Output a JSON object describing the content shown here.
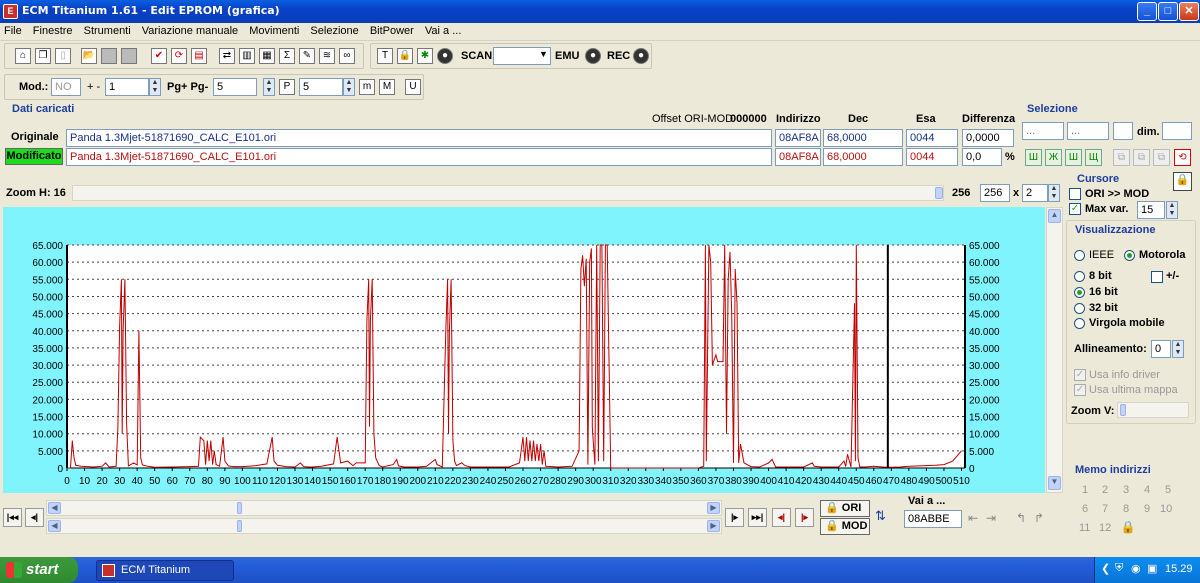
{
  "window": {
    "title": "ECM Titanium 1.61 - Edit EPROM (grafica)",
    "icon": "app-icon"
  },
  "menu": [
    "File",
    "Finestre",
    "Strumenti",
    "Variazione manuale",
    "Movimenti",
    "Selezione",
    "BitPower",
    "Vai a ..."
  ],
  "toolbar1": {
    "scan_label": "SCAN",
    "scan_value": "",
    "emu_label": "EMU",
    "rec_label": "REC"
  },
  "toolbar2": {
    "mod_label": "Mod.:",
    "mod_value": "NO",
    "step_label": "+ -",
    "step_value": "1",
    "pg_label": "Pg+ Pg-",
    "pg_value": "5",
    "p_value": "5"
  },
  "data_panel": {
    "title": "Dati caricati",
    "offset_label": "Offset ORI-MOD",
    "offset_value": "000000",
    "col_indirizzo": "Indirizzo",
    "col_dec": "Dec",
    "col_esa": "Esa",
    "col_diff": "Differenza",
    "orig_label": "Originale",
    "orig_file": "Panda 1.3Mjet-51871690_CALC_E101.ori",
    "orig_addr": "08AF8A",
    "orig_dec": "68,0000",
    "orig_esa": "0044",
    "orig_diff": "0,0000",
    "mod_label": "Modificato",
    "mod_file": "Panda 1.3Mjet-51871690_CALC_E101.ori",
    "mod_addr": "08AF8A",
    "mod_dec": "68,0000",
    "mod_esa": "0044",
    "mod_diff": "0,0",
    "pct": "%"
  },
  "selezione": {
    "title": "Selezione",
    "f1": "...",
    "f2": "...",
    "dim_label": "dim."
  },
  "zoom": {
    "label": "Zoom H: 16",
    "value_text": "256",
    "field": "256",
    "x": "x",
    "mult": "2"
  },
  "cursore": {
    "title": "Cursore",
    "ori_mod": "ORI >> MOD",
    "maxvar_label": "Max var.",
    "maxvar_value": "15"
  },
  "visualizzazione": {
    "title": "Visualizzazione",
    "ieee": "IEEE",
    "motorola": "Motorola",
    "b8": "8 bit",
    "pm": "+/-",
    "b16": "16 bit",
    "b32": "32 bit",
    "virgola": "Virgola mobile",
    "allineamento_label": "Allineamento:",
    "allineamento_value": "0",
    "usa_info": "Usa info driver",
    "usa_ultima": "Usa ultima mappa",
    "zoomv": "Zoom V:"
  },
  "memo": {
    "title": "Memo indirizzi",
    "nums": [
      "1",
      "2",
      "3",
      "4",
      "5",
      "6",
      "7",
      "8",
      "9",
      "10",
      "11",
      "12"
    ]
  },
  "nav": {
    "ori": "ORI",
    "mod": "MOD",
    "vai_label": "Vai a ...",
    "vai_value": "08ABBE"
  },
  "taskbar": {
    "start": "start",
    "item": "ECM Titanium",
    "clock": "15.29"
  },
  "chart_data": {
    "type": "line",
    "title": "",
    "xlabel": "",
    "ylabel": "",
    "xlim": [
      0,
      512
    ],
    "ylim": [
      0,
      65000
    ],
    "x_ticks": [
      0,
      10,
      20,
      30,
      40,
      50,
      60,
      70,
      80,
      90,
      100,
      110,
      120,
      130,
      140,
      150,
      160,
      170,
      180,
      190,
      200,
      210,
      220,
      230,
      240,
      250,
      260,
      270,
      280,
      290,
      300,
      310,
      320,
      330,
      340,
      350,
      360,
      370,
      380,
      390,
      400,
      410,
      420,
      430,
      440,
      450,
      460,
      470,
      480,
      490,
      500,
      510
    ],
    "y_ticks": [
      "0",
      "5.000",
      "10.000",
      "15.000",
      "20.000",
      "25.000",
      "30.000",
      "35.000",
      "40.000",
      "45.000",
      "50.000",
      "55.000",
      "60.000",
      "65.000"
    ],
    "grid": "horizontal dashed",
    "series": [
      {
        "color": "#c00000",
        "points": [
          [
            0,
            0
          ],
          [
            2,
            0
          ],
          [
            3,
            8000
          ],
          [
            4,
            3000
          ],
          [
            5,
            800
          ],
          [
            8,
            500
          ],
          [
            15,
            300
          ],
          [
            20,
            500
          ],
          [
            22,
            1500
          ],
          [
            24,
            300
          ],
          [
            28,
            500
          ],
          [
            29,
            12000
          ],
          [
            30,
            41000
          ],
          [
            31,
            55000
          ],
          [
            31.5,
            10000
          ],
          [
            32,
            40000
          ],
          [
            33,
            55000
          ],
          [
            34,
            13000
          ],
          [
            35,
            600
          ],
          [
            38,
            1500
          ],
          [
            40,
            900
          ],
          [
            41,
            40000
          ],
          [
            42,
            3000
          ],
          [
            43,
            900
          ],
          [
            46,
            500
          ],
          [
            50,
            200
          ],
          [
            60,
            300
          ],
          [
            70,
            400
          ],
          [
            75,
            500
          ],
          [
            76,
            9000
          ],
          [
            78,
            8000
          ],
          [
            79,
            1000
          ],
          [
            80,
            8000
          ],
          [
            81,
            2000
          ],
          [
            82,
            8000
          ],
          [
            83,
            1000
          ],
          [
            84,
            5000
          ],
          [
            85,
            1000
          ],
          [
            87,
            500
          ],
          [
            89,
            9000
          ],
          [
            90,
            2000
          ],
          [
            92,
            600
          ],
          [
            95,
            400
          ],
          [
            100,
            400
          ],
          [
            108,
            700
          ],
          [
            111,
            1000
          ],
          [
            114,
            1200
          ],
          [
            117,
            9000
          ],
          [
            118,
            2000
          ],
          [
            120,
            800
          ],
          [
            125,
            400
          ],
          [
            130,
            300
          ],
          [
            133,
            1500
          ],
          [
            135,
            400
          ],
          [
            138,
            300
          ],
          [
            140,
            300
          ],
          [
            145,
            500
          ],
          [
            152,
            1200
          ],
          [
            154,
            9000
          ],
          [
            156,
            1500
          ],
          [
            160,
            2000
          ],
          [
            163,
            700
          ],
          [
            165,
            1500
          ],
          [
            170,
            1500
          ],
          [
            171,
            43000
          ],
          [
            172,
            55000
          ],
          [
            172.5,
            12000
          ],
          [
            173,
            43000
          ],
          [
            174,
            55000
          ],
          [
            175,
            10000
          ],
          [
            176,
            3000
          ],
          [
            178,
            700
          ],
          [
            180,
            300
          ],
          [
            186,
            1000
          ],
          [
            188,
            2500
          ],
          [
            189,
            600
          ],
          [
            192,
            300
          ],
          [
            200,
            300
          ],
          [
            205,
            500
          ],
          [
            210,
            2500
          ],
          [
            211,
            1000
          ],
          [
            214,
            300
          ],
          [
            216,
            40000
          ],
          [
            217,
            55000
          ],
          [
            217.5,
            10000
          ],
          [
            218,
            40000
          ],
          [
            219,
            55000
          ],
          [
            220,
            8000
          ],
          [
            221,
            2000
          ],
          [
            222,
            700
          ],
          [
            225,
            1500
          ],
          [
            227,
            700
          ],
          [
            230,
            300
          ],
          [
            240,
            300
          ],
          [
            248,
            300
          ],
          [
            252,
            300
          ],
          [
            258,
            1500
          ],
          [
            260,
            9000
          ],
          [
            261,
            2000
          ],
          [
            262,
            9000
          ],
          [
            263,
            2000
          ],
          [
            264,
            8000
          ],
          [
            265,
            2000
          ],
          [
            266,
            8000
          ],
          [
            267,
            2000
          ],
          [
            268,
            7000
          ],
          [
            269,
            2000
          ],
          [
            270,
            7000
          ],
          [
            271,
            1000
          ],
          [
            272,
            5000
          ],
          [
            273,
            500
          ],
          [
            280,
            300
          ],
          [
            288,
            500
          ],
          [
            292,
            5000
          ],
          [
            293,
            58000
          ],
          [
            294,
            62000
          ],
          [
            295,
            53000
          ],
          [
            296,
            61000
          ],
          [
            297,
            1000
          ],
          [
            298,
            60000
          ],
          [
            299,
            64000
          ],
          [
            299.5,
            12000
          ],
          [
            300,
            8000
          ],
          [
            301,
            1000
          ],
          [
            302,
            65000
          ],
          [
            303,
            2000
          ],
          [
            304,
            65000
          ],
          [
            305,
            65000
          ],
          [
            306,
            2000
          ],
          [
            307,
            65000
          ],
          [
            308,
            65000
          ],
          [
            310,
            0
          ],
          [
            312,
            0
          ],
          [
            320,
            0
          ],
          [
            330,
            0
          ],
          [
            340,
            0
          ],
          [
            350,
            0
          ],
          [
            360,
            0
          ],
          [
            363,
            500
          ],
          [
            364,
            65000
          ],
          [
            364.5,
            2000
          ],
          [
            366,
            65000
          ],
          [
            367,
            60000
          ],
          [
            368,
            30000
          ],
          [
            370,
            33000
          ],
          [
            371,
            31000
          ],
          [
            374,
            31000
          ],
          [
            375,
            65000
          ],
          [
            376,
            10000
          ],
          [
            377,
            55000
          ],
          [
            378,
            63000
          ],
          [
            379,
            45000
          ],
          [
            380,
            1500
          ],
          [
            381,
            58000
          ],
          [
            382,
            48000
          ],
          [
            383,
            1500
          ],
          [
            384,
            7000
          ],
          [
            386,
            1500
          ],
          [
            390,
            400
          ],
          [
            395,
            300
          ],
          [
            400,
            1500
          ],
          [
            402,
            2500
          ],
          [
            404,
            300
          ],
          [
            410,
            300
          ],
          [
            420,
            300
          ],
          [
            425,
            1500
          ],
          [
            426,
            500
          ],
          [
            430,
            300
          ],
          [
            440,
            300
          ],
          [
            443,
            2000
          ],
          [
            444,
            400
          ],
          [
            445,
            4000
          ],
          [
            447,
            300
          ],
          [
            449,
            48000
          ],
          [
            449.5,
            2000
          ],
          [
            450,
            65000
          ],
          [
            451,
            3000
          ],
          [
            452,
            300
          ],
          [
            455,
            300
          ],
          [
            460,
            500
          ],
          [
            465,
            300
          ],
          [
            470,
            200
          ],
          [
            475,
            300
          ],
          [
            480,
            500
          ],
          [
            490,
            700
          ],
          [
            495,
            800
          ],
          [
            500,
            1000
          ],
          [
            505,
            2000
          ],
          [
            510,
            5000
          ]
        ]
      }
    ],
    "cursor_x": 468
  }
}
